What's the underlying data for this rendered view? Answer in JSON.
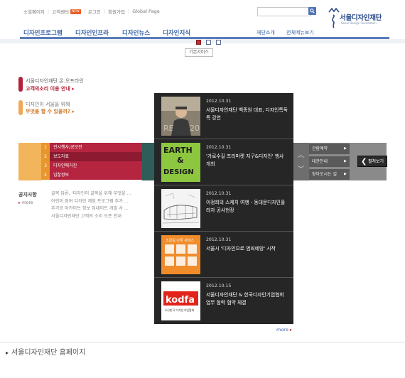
{
  "header": {
    "top_links": [
      "소셜페이지",
      "고객센터",
      "로그인",
      "회원가입",
      "Global Page"
    ],
    "new_badge": "NEW",
    "search_placeholder": "",
    "logo_title": "서울디자인재단",
    "logo_subtitle": "Seoul Design Foundation"
  },
  "nav": {
    "main": [
      "디자인프로그램",
      "디자인인프라",
      "디자인뉴스",
      "디자인지식"
    ],
    "sub": [
      "재단소개",
      "전체메뉴보기"
    ]
  },
  "pager": {
    "count": 3,
    "active_index": 0
  },
  "basic_service_button": "기본서비스",
  "promos": [
    {
      "line1": "서울디자인재단 온.오프라인",
      "line2": "고객의소리 이용 안내",
      "color": "#b3223a"
    },
    {
      "line1": "디자인이 서울을 위해",
      "line2": "무엇을 할 수 있을까?",
      "color": "#d0772a"
    }
  ],
  "band_menu": [
    {
      "num": "1",
      "label": "전시행사/공모전",
      "bg": "#b52540"
    },
    {
      "num": "2",
      "label": "보도자료",
      "bg": "#8c1a30"
    },
    {
      "num": "3",
      "label": "디자인매거진",
      "bg": "#b52540"
    },
    {
      "num": "4",
      "label": "입찰정보",
      "bg": "#b52540"
    }
  ],
  "band_buttons": [
    "관람예약",
    "대관안내",
    "찾아오시는 길"
  ],
  "close_button": "펼쳐보기",
  "notice": {
    "title": "공지사항",
    "more": "more",
    "items": [
      "골목 답론, '디자인이 골목을 위해 무엇을 ...",
      "어린이 참여 디자인 체험 프로그램 추가 ...",
      "추가공 아카이브 정보 업데이트 개발 사 ...",
      "서울디자인재단 고객의 소리 오픈 안내"
    ]
  },
  "news": [
    {
      "date": "2012.10.31",
      "title": "서울디자인재단 백종원 대표, 디자인특독특 강연",
      "thumb": "speaker"
    },
    {
      "date": "2012.10.31",
      "title": "'가로수길 프리마켓 지구&디자인' 행사 개최",
      "thumb": "earth",
      "thumb_text": [
        "EARTH",
        "&",
        "DESIGN"
      ]
    },
    {
      "date": "2012.10.31",
      "title": "이정희의 스케치 여행 - 동대문디자인플라자 공사현장",
      "thumb": "sketch"
    },
    {
      "date": "2012.10.31",
      "title": "서울시 '디자인으로 범죄예방' 시작",
      "thumb": "crime",
      "thumb_text": [
        "소금길 나루 서비스"
      ]
    },
    {
      "date": "2012.10.15",
      "title": "서울디자인재단 & 한국디자인기업협회 업무 협력 협약 체결",
      "thumb": "kodfa",
      "thumb_text": [
        "kodfa",
        "(사)한국 디자인기업협회"
      ]
    }
  ],
  "news_more": "more",
  "footer": {
    "label": "서울디자인재단 홈페이지"
  }
}
